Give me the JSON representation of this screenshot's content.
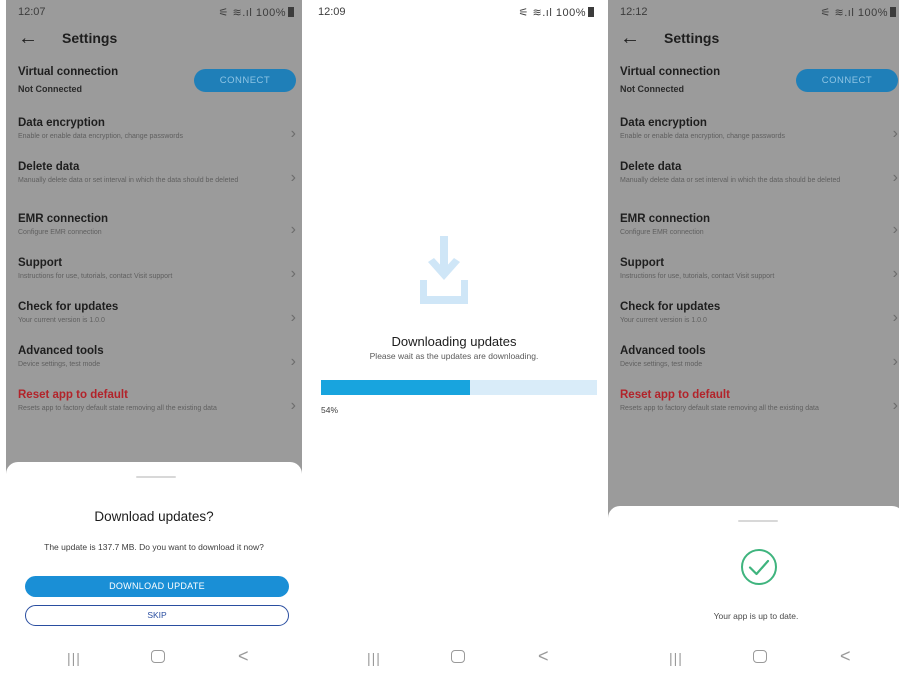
{
  "settings": {
    "title": "Settings",
    "virtual_connection": {
      "title": "Virtual connection",
      "status": "Not Connected",
      "connect_label": "CONNECT"
    },
    "rows": [
      {
        "title": "Data encryption",
        "sub": "Enable or enable data encryption, change passwords"
      },
      {
        "title": "Delete data",
        "sub": "Manually delete data or set interval in which the data should be deleted"
      },
      {
        "title": "EMR connection",
        "sub": "Configure EMR connection"
      },
      {
        "title": "Support",
        "sub": "Instructions for use, tutorials, contact Visit support"
      },
      {
        "title": "Check for updates",
        "sub": "Your current version is 1.0.0"
      },
      {
        "title": "Advanced tools",
        "sub": "Device settings, test mode"
      },
      {
        "title": "Reset app to default",
        "sub": "Resets app to factory default state removing all the existing data"
      }
    ]
  },
  "screens": [
    {
      "time": "12:07",
      "status_icons": "⚟ ≋.ıl 100%"
    },
    {
      "time": "12:09",
      "status_icons": "⚟ ≋.ıl 100%"
    },
    {
      "time": "12:12",
      "status_icons": "⚟ ≋.ıl 100%"
    }
  ],
  "download_dialog": {
    "title": "Download updates?",
    "message": "The update is 137.7 MB. Do you want to download it now?",
    "primary_label": "DOWNLOAD UPDATE",
    "secondary_label": "SKIP"
  },
  "downloading": {
    "title": "Downloading updates",
    "subtitle": "Please wait as the updates are downloading.",
    "progress_label": "54%",
    "progress": 0.54
  },
  "up_to_date": {
    "message": "Your app is up to date."
  },
  "navbar": {
    "recent_glyph": "|||",
    "back_glyph": "<"
  },
  "colors": {
    "accent": "#1a8fd6",
    "progress": "#18a4de",
    "success": "#3fb47e",
    "reset_red": "#b2232a"
  }
}
